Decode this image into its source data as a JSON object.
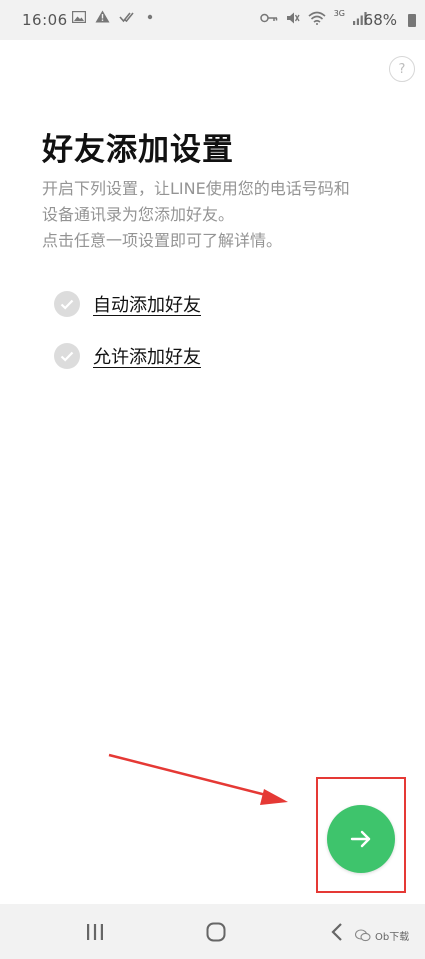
{
  "status_bar": {
    "time": "16:06",
    "network_label": "3G",
    "battery": "68%",
    "icons": [
      "image-icon",
      "alert-icon",
      "double-check-icon",
      "dot-icon",
      "key-icon",
      "mute-icon",
      "wifi-icon",
      "signal-icon",
      "battery-icon"
    ]
  },
  "help": {
    "label": "?"
  },
  "page": {
    "title": "好友添加设置",
    "description_lines": [
      "开启下列设置，让LINE使用您的电话号码和",
      "设备通讯录为您添加好友。",
      "点击任意一项设置即可了解详情。"
    ]
  },
  "options": [
    {
      "label": "自动添加好友",
      "checked": true
    },
    {
      "label": "允许添加好友",
      "checked": true
    }
  ],
  "next_button": {
    "icon": "arrow-right-icon",
    "color": "#3ec46c"
  },
  "annotation": {
    "color": "#e53935"
  },
  "watermark": {
    "text": "Ob下载"
  }
}
